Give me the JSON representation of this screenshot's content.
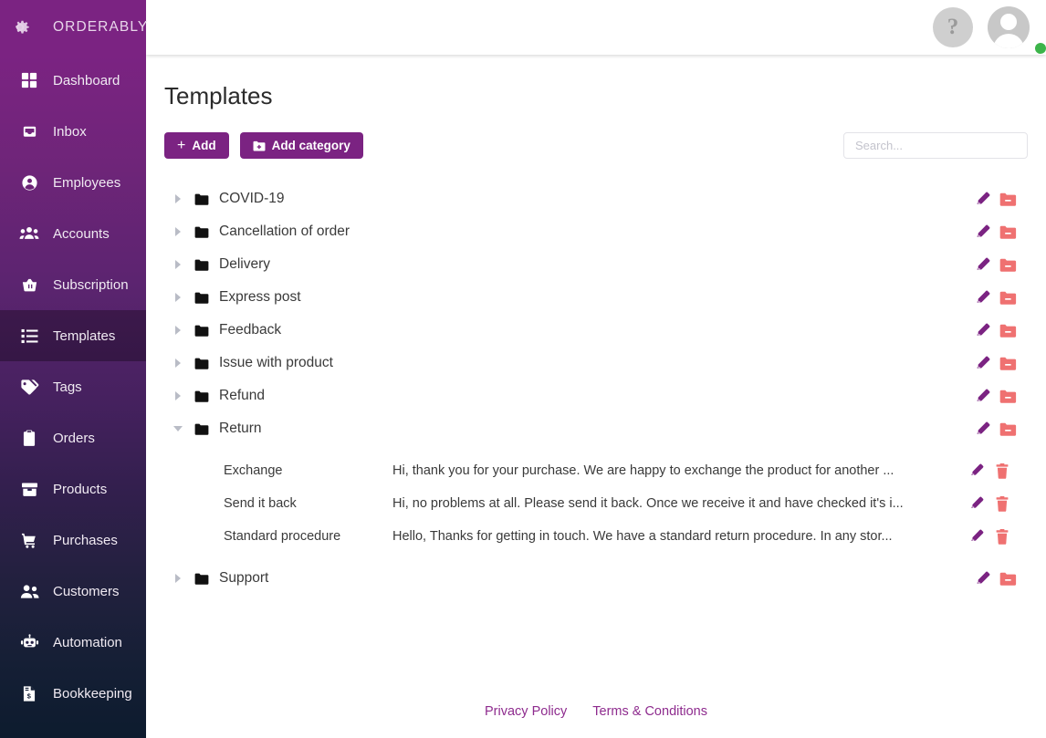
{
  "brand": {
    "name": "ORDERABLY",
    "logo_icon": "gear-icon"
  },
  "sidebar": {
    "items": [
      {
        "label": "Dashboard",
        "icon": "grid-icon",
        "active": false
      },
      {
        "label": "Inbox",
        "icon": "inbox-icon",
        "active": false
      },
      {
        "label": "Employees",
        "icon": "user-circle-icon",
        "active": false
      },
      {
        "label": "Accounts",
        "icon": "users-group-icon",
        "active": false
      },
      {
        "label": "Subscription",
        "icon": "basket-icon",
        "active": false
      },
      {
        "label": "Templates",
        "icon": "list-icon",
        "active": true
      },
      {
        "label": "Tags",
        "icon": "tags-icon",
        "active": false
      },
      {
        "label": "Orders",
        "icon": "clipboard-icon",
        "active": false
      },
      {
        "label": "Products",
        "icon": "box-icon",
        "active": false
      },
      {
        "label": "Purchases",
        "icon": "cart-icon",
        "active": false
      },
      {
        "label": "Customers",
        "icon": "people-icon",
        "active": false
      },
      {
        "label": "Automation",
        "icon": "robot-icon",
        "active": false
      },
      {
        "label": "Bookkeeping",
        "icon": "invoice-icon",
        "active": false
      }
    ]
  },
  "topbar": {
    "help_icon": "question-mark-icon",
    "help_label": "?",
    "avatar_icon": "avatar-icon",
    "status": "online"
  },
  "page": {
    "title": "Templates"
  },
  "toolbar": {
    "add_label": "Add",
    "add_icon": "plus-icon",
    "add_category_label": "Add category",
    "add_category_icon": "folder-plus-icon"
  },
  "search": {
    "placeholder": "Search...",
    "value": ""
  },
  "tree": {
    "edit_icon": "pencil-icon",
    "delete_category_icon": "folder-minus-icon",
    "delete_template_icon": "trash-icon",
    "categories": [
      {
        "name": "COVID-19",
        "expanded": false,
        "templates": []
      },
      {
        "name": "Cancellation of order",
        "expanded": false,
        "templates": []
      },
      {
        "name": "Delivery",
        "expanded": false,
        "templates": []
      },
      {
        "name": "Express post",
        "expanded": false,
        "templates": []
      },
      {
        "name": "Feedback",
        "expanded": false,
        "templates": []
      },
      {
        "name": "Issue with product",
        "expanded": false,
        "templates": []
      },
      {
        "name": "Refund",
        "expanded": false,
        "templates": []
      },
      {
        "name": "Return",
        "expanded": true,
        "templates": [
          {
            "name": "Exchange",
            "preview": "Hi, thank you for your purchase. We are happy to exchange the product for another ..."
          },
          {
            "name": "Send it back",
            "preview": "Hi, no problems at all. Please send it back. Once we receive it and have checked it's i..."
          },
          {
            "name": "Standard procedure",
            "preview": "Hello, Thanks for getting in touch. We have a standard return procedure. In any stor..."
          }
        ]
      },
      {
        "name": "Support",
        "expanded": false,
        "templates": []
      }
    ]
  },
  "footer": {
    "privacy_label": "Privacy Policy",
    "terms_label": "Terms & Conditions"
  },
  "colors": {
    "brand_purple": "#7b2382",
    "sidebar_bottom": "#0d1b2e",
    "action_edit": "#7b2382",
    "action_delete": "#ef7171",
    "status_online": "#3cb44a",
    "link": "#8e2b8e"
  }
}
